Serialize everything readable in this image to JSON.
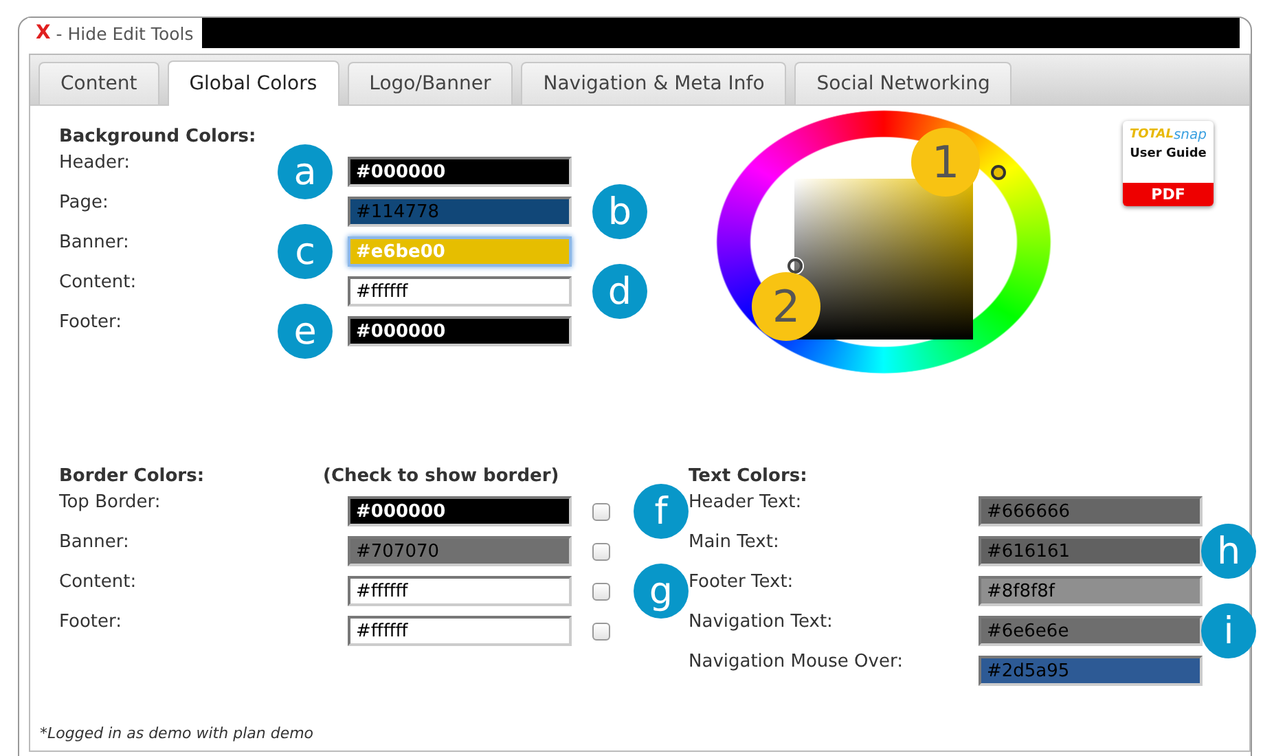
{
  "edit_tools_toggle": {
    "icon": "X",
    "label": "- Hide Edit Tools"
  },
  "tabs": [
    {
      "label": "Content",
      "selected": false
    },
    {
      "label": "Global Colors",
      "selected": true
    },
    {
      "label": "Logo/Banner",
      "selected": false
    },
    {
      "label": "Navigation & Meta Info",
      "selected": false
    },
    {
      "label": "Social Networking",
      "selected": false
    }
  ],
  "background_colors": {
    "title": "Background Colors:",
    "rows": [
      {
        "label": "Header:",
        "value": "#000000",
        "color": "#000000",
        "light_text": true,
        "focused": false,
        "callout_left": "a"
      },
      {
        "label": "Page:",
        "value": "#114778",
        "color": "#114778",
        "light_text": false,
        "focused": false,
        "callout_right": "b"
      },
      {
        "label": "Banner:",
        "value": "#e6be00",
        "color": "#e6be00",
        "light_text": true,
        "focused": true,
        "callout_left": "c"
      },
      {
        "label": "Content:",
        "value": "#ffffff",
        "color": "#ffffff",
        "light_text": false,
        "focused": false,
        "callout_right": "d"
      },
      {
        "label": "Footer:",
        "value": "#000000",
        "color": "#000000",
        "light_text": true,
        "focused": false,
        "callout_left": "e"
      }
    ]
  },
  "color_picker": {
    "hue_callout": "1",
    "shade_callout": "2"
  },
  "user_guide": {
    "brand": [
      "TOTAL",
      "snap"
    ],
    "label": "User Guide",
    "badge": "PDF"
  },
  "border_colors": {
    "title": "Border Colors:",
    "hint": "(Check to show border)",
    "rows": [
      {
        "label": "Top Border:",
        "value": "#000000",
        "color": "#000000",
        "light_text": true,
        "checked": false
      },
      {
        "label": "Banner:",
        "value": "#707070",
        "color": "#707070",
        "light_text": false,
        "checked": false
      },
      {
        "label": "Content:",
        "value": "#ffffff",
        "color": "#ffffff",
        "light_text": false,
        "checked": false
      },
      {
        "label": "Footer:",
        "value": "#ffffff",
        "color": "#ffffff",
        "light_text": false,
        "checked": false
      }
    ]
  },
  "text_colors": {
    "title": "Text Colors:",
    "rows": [
      {
        "label": "Header Text:",
        "value": "#666666",
        "color": "#666666",
        "light_text": false,
        "callout_left": "f"
      },
      {
        "label": "Main Text:",
        "value": "#616161",
        "color": "#616161",
        "light_text": false,
        "callout_right": "h"
      },
      {
        "label": "Footer Text:",
        "value": "#8f8f8f",
        "color": "#8f8f8f",
        "light_text": false,
        "callout_left": "g"
      },
      {
        "label": "Navigation Text:",
        "value": "#6e6e6e",
        "color": "#6e6e6e",
        "light_text": false,
        "callout_right": "i"
      },
      {
        "label": "Navigation Mouse Over:",
        "value": "#2d5a95",
        "color": "#2d5a95",
        "light_text": false
      }
    ]
  },
  "footer_note": "*Logged in as demo with plan demo"
}
